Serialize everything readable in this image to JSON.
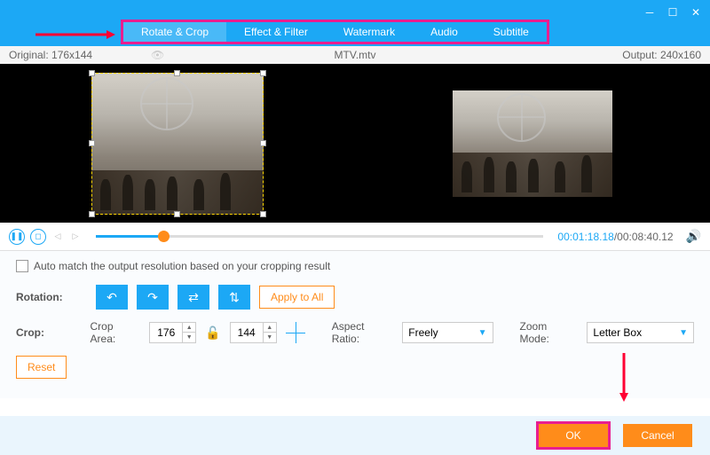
{
  "tabs": {
    "rotate_crop": "Rotate & Crop",
    "effect_filter": "Effect & Filter",
    "watermark": "Watermark",
    "audio": "Audio",
    "subtitle": "Subtitle"
  },
  "info": {
    "original": "Original: 176x144",
    "filename": "MTV.mtv",
    "output": "Output: 240x160"
  },
  "playback": {
    "current": "00:01:18.18",
    "duration": "/00:08:40.12"
  },
  "settings": {
    "auto_match": "Auto match the output resolution based on your cropping result",
    "rotation_label": "Rotation:",
    "apply_all": "Apply to All",
    "crop_label": "Crop:",
    "crop_area_label": "Crop Area:",
    "crop_w": "176",
    "crop_h": "144",
    "aspect_label": "Aspect Ratio:",
    "aspect_value": "Freely",
    "zoom_label": "Zoom Mode:",
    "zoom_value": "Letter Box",
    "reset": "Reset"
  },
  "footer": {
    "ok": "OK",
    "cancel": "Cancel"
  }
}
